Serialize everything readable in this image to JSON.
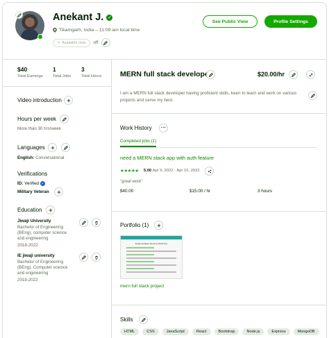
{
  "profile": {
    "name": "Anekant J.",
    "location": "Tikamgarh, India – 11:09 am local time",
    "availability_label": "Available now",
    "availability_state": "off"
  },
  "buttons": {
    "public_view": "See Public View",
    "profile_settings": "Profile Settings"
  },
  "stats": [
    {
      "value": "$40",
      "label": "Total Earnings"
    },
    {
      "value": "1",
      "label": "Total Jobs"
    },
    {
      "value": "3",
      "label": "Total Hours"
    }
  ],
  "sidebar": {
    "video_intro": "Video introduction",
    "hours_title": "Hours per week",
    "hours_value": "More than 30 hrs/week",
    "languages_title": "Languages",
    "language_name": "English:",
    "language_level": "Conversational",
    "verifications_title": "Verifications",
    "id_label": "ID:",
    "id_value": "Verified",
    "military": "Military Veteran",
    "education_title": "Education",
    "education": [
      {
        "school": "Jiwaji University",
        "degree": "Bachelor of Engineering (BEng), computer science and engineering",
        "years": "2018-2022"
      },
      {
        "school": "IE jiwaji university",
        "degree": "Bachelor of Engineering (BEng), Computer science and engineering",
        "years": "2018-2022"
      }
    ]
  },
  "main": {
    "title": "MERN full stack developer",
    "rate": "$20.00/hr",
    "overview": "I am a MERN full stack developer having proficient skills, keen to learn and work on various projects and serve my best.",
    "work_history_title": "Work History",
    "tab": "Completed jobs (1)",
    "job": {
      "title": "need a MERN stack app with auth feature",
      "stars": "★★★★★",
      "rating": "5.00",
      "dates": "Apr 9, 2022 - Apr 10, 2022",
      "feedback": "\"great work\"",
      "earned": "$40.00",
      "rate": "$15.00",
      "rate_unit": "/ hr",
      "hours": "3 hours"
    },
    "portfolio_title": "Portfolio (1)",
    "portfolio_item": "mern full stack project",
    "portfolio_thumb_title": "Implementation Done by Mudit Sys",
    "skills_title": "Skills",
    "skills": [
      "HTML",
      "CSS",
      "JavaScript",
      "React",
      "Bootstrap",
      "Node.js",
      "Express",
      "MongoDB"
    ]
  },
  "colors": {
    "brand": "#14a800",
    "brand_dark": "#108a00",
    "border": "#d5e0d5",
    "text": "#001e00",
    "muted": "#5e6d55"
  }
}
